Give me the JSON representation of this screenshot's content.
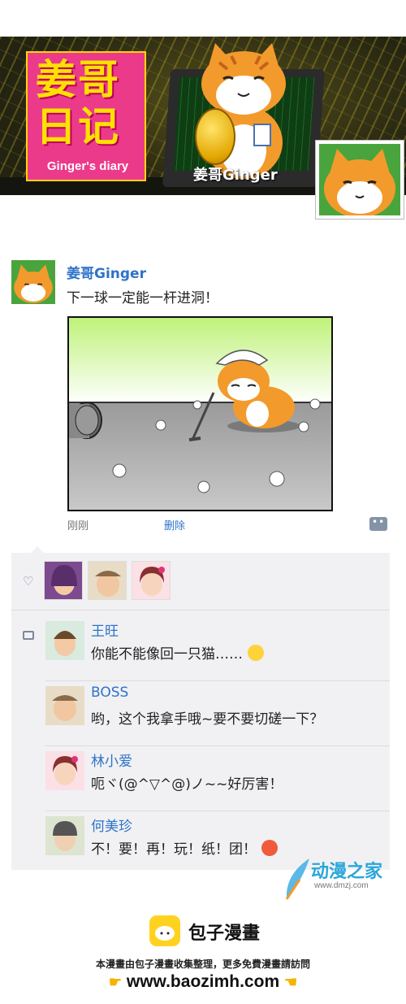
{
  "banner": {
    "title_line1": "姜哥",
    "title_line2": "日记",
    "title_en": "Ginger's diary",
    "name_tag": "姜哥Ginger"
  },
  "post": {
    "author": "姜哥Ginger",
    "text": "下一球一定能一杆进洞！",
    "time": "刚刚",
    "delete_label": "删除"
  },
  "comments": [
    {
      "name": "王旺",
      "text": "你能不能像回一只猫……",
      "emoji": "crying-emoji"
    },
    {
      "name": "BOSS",
      "text": "哟，这个我拿手哦~要不要切磋一下？"
    },
    {
      "name": "林小爱",
      "text": "呃ヾ(@^▽^@)ノ~~好厉害！"
    },
    {
      "name": "何美珍",
      "text": "不！要！再！玩！纸！团！",
      "emoji": "angry-emoji"
    }
  ],
  "watermark": {
    "title": "动漫之家",
    "url": "www.dmzj.com"
  },
  "footer": {
    "brand": "包子漫畫",
    "description": "本漫畫由包子漫畫收集整理，更多免費漫畫請訪問",
    "url": "www.baozimh.com"
  },
  "colors": {
    "link_blue": "#2e73c9",
    "title_pink": "#ec3a8b",
    "title_yellow": "#ffe100",
    "panel_bg": "#f1f1f3"
  }
}
